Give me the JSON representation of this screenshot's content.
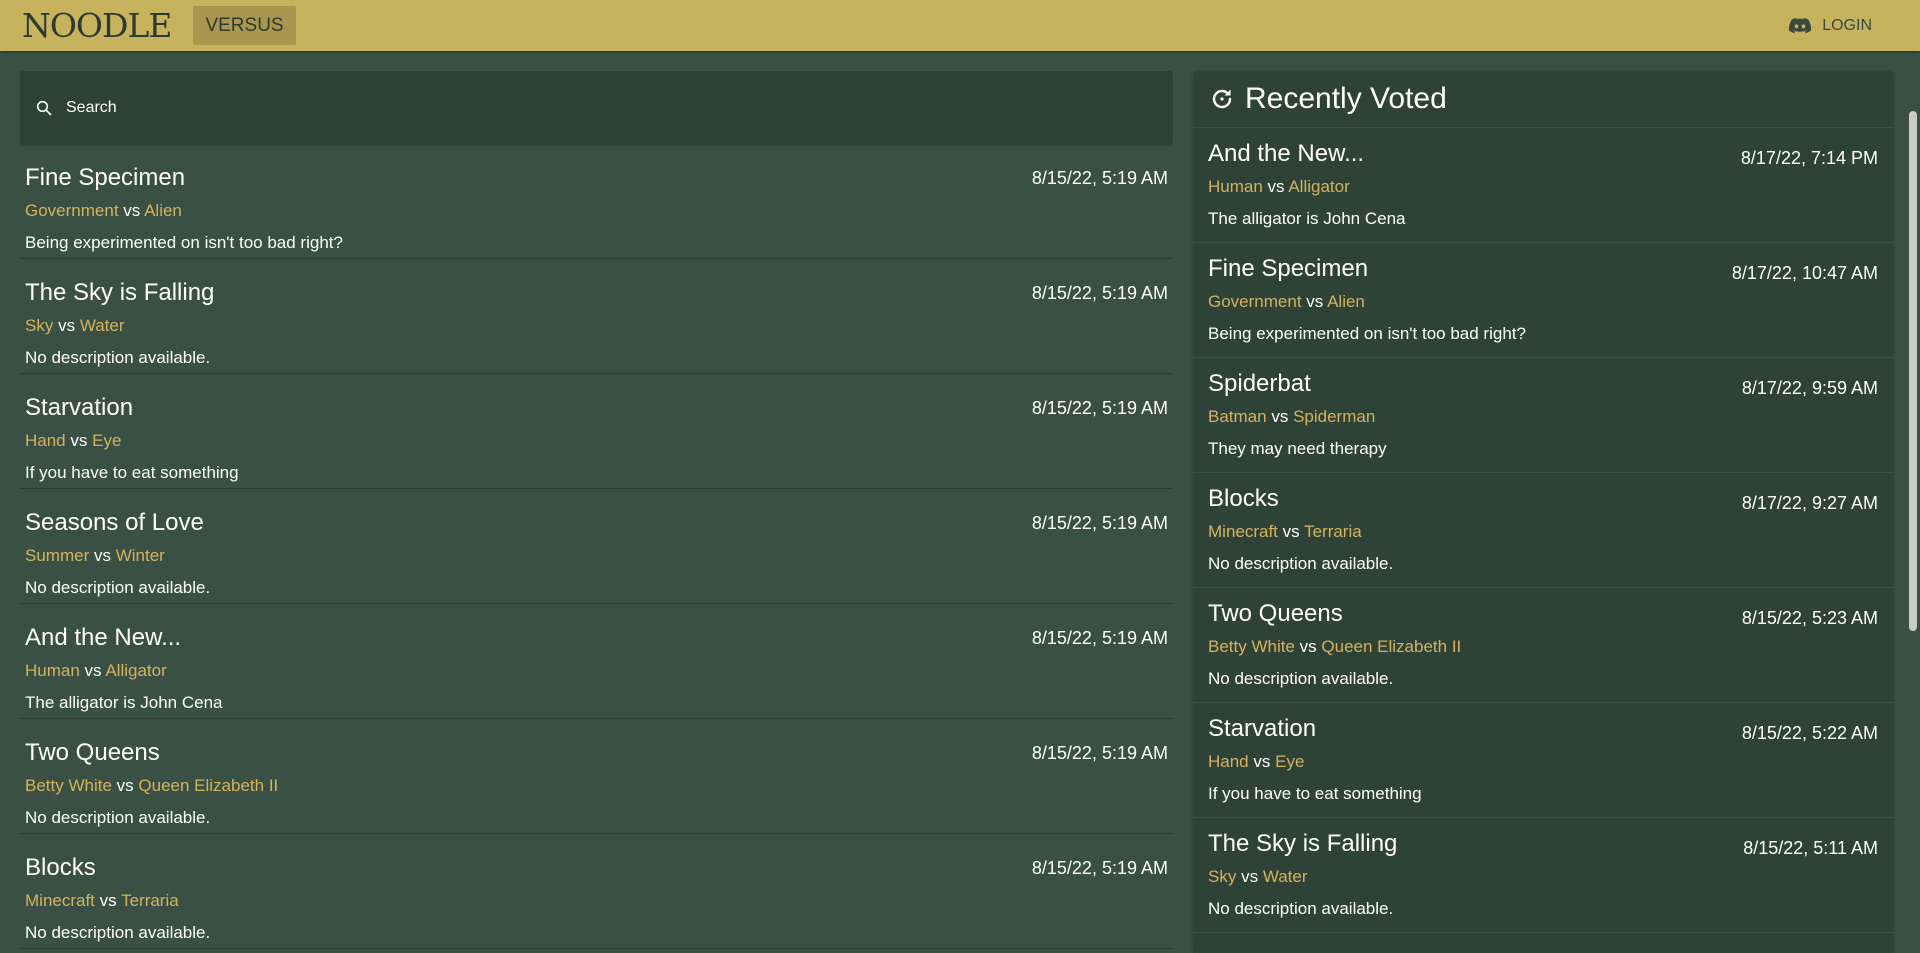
{
  "header": {
    "logo": "NOODLE",
    "nav_versus": "VERSUS",
    "login": "LOGIN",
    "login_icon": "discord-icon"
  },
  "search": {
    "placeholder": "Search",
    "icon": "search-icon"
  },
  "vs_word": "vs",
  "matchups": [
    {
      "title": "Fine Specimen",
      "date": "8/15/22, 5:19 AM",
      "a": "Government",
      "b": "Alien",
      "desc": "Being experimented on isn't too bad right?"
    },
    {
      "title": "The Sky is Falling",
      "date": "8/15/22, 5:19 AM",
      "a": "Sky",
      "b": "Water",
      "desc": "No description available."
    },
    {
      "title": "Starvation",
      "date": "8/15/22, 5:19 AM",
      "a": "Hand",
      "b": "Eye",
      "desc": "If you have to eat something"
    },
    {
      "title": "Seasons of Love",
      "date": "8/15/22, 5:19 AM",
      "a": "Summer",
      "b": "Winter",
      "desc": "No description available."
    },
    {
      "title": "And the New...",
      "date": "8/15/22, 5:19 AM",
      "a": "Human",
      "b": "Alligator",
      "desc": "The alligator is John Cena"
    },
    {
      "title": "Two Queens",
      "date": "8/15/22, 5:19 AM",
      "a": "Betty White",
      "b": "Queen Elizabeth II",
      "desc": "No description available."
    },
    {
      "title": "Blocks",
      "date": "8/15/22, 5:19 AM",
      "a": "Minecraft",
      "b": "Terraria",
      "desc": "No description available."
    }
  ],
  "recent": {
    "title": "Recently Voted",
    "icon": "refresh-icon",
    "items": [
      {
        "title": "And the New...",
        "date": "8/17/22, 7:14 PM",
        "a": "Human",
        "b": "Alligator",
        "desc": "The alligator is John Cena"
      },
      {
        "title": "Fine Specimen",
        "date": "8/17/22, 10:47 AM",
        "a": "Government",
        "b": "Alien",
        "desc": "Being experimented on isn't too bad right?"
      },
      {
        "title": "Spiderbat",
        "date": "8/17/22, 9:59 AM",
        "a": "Batman",
        "b": "Spiderman",
        "desc": "They may need therapy"
      },
      {
        "title": "Blocks",
        "date": "8/17/22, 9:27 AM",
        "a": "Minecraft",
        "b": "Terraria",
        "desc": "No description available."
      },
      {
        "title": "Two Queens",
        "date": "8/15/22, 5:23 AM",
        "a": "Betty White",
        "b": "Queen Elizabeth II",
        "desc": "No description available."
      },
      {
        "title": "Starvation",
        "date": "8/15/22, 5:22 AM",
        "a": "Hand",
        "b": "Eye",
        "desc": "If you have to eat something"
      },
      {
        "title": "The Sky is Falling",
        "date": "8/15/22, 5:11 AM",
        "a": "Sky",
        "b": "Water",
        "desc": "No description available."
      }
    ]
  },
  "colors": {
    "topbar": "#c7b25e",
    "background": "#3a5045",
    "panel": "#2f4237",
    "option_accent": "#d4b35c"
  }
}
